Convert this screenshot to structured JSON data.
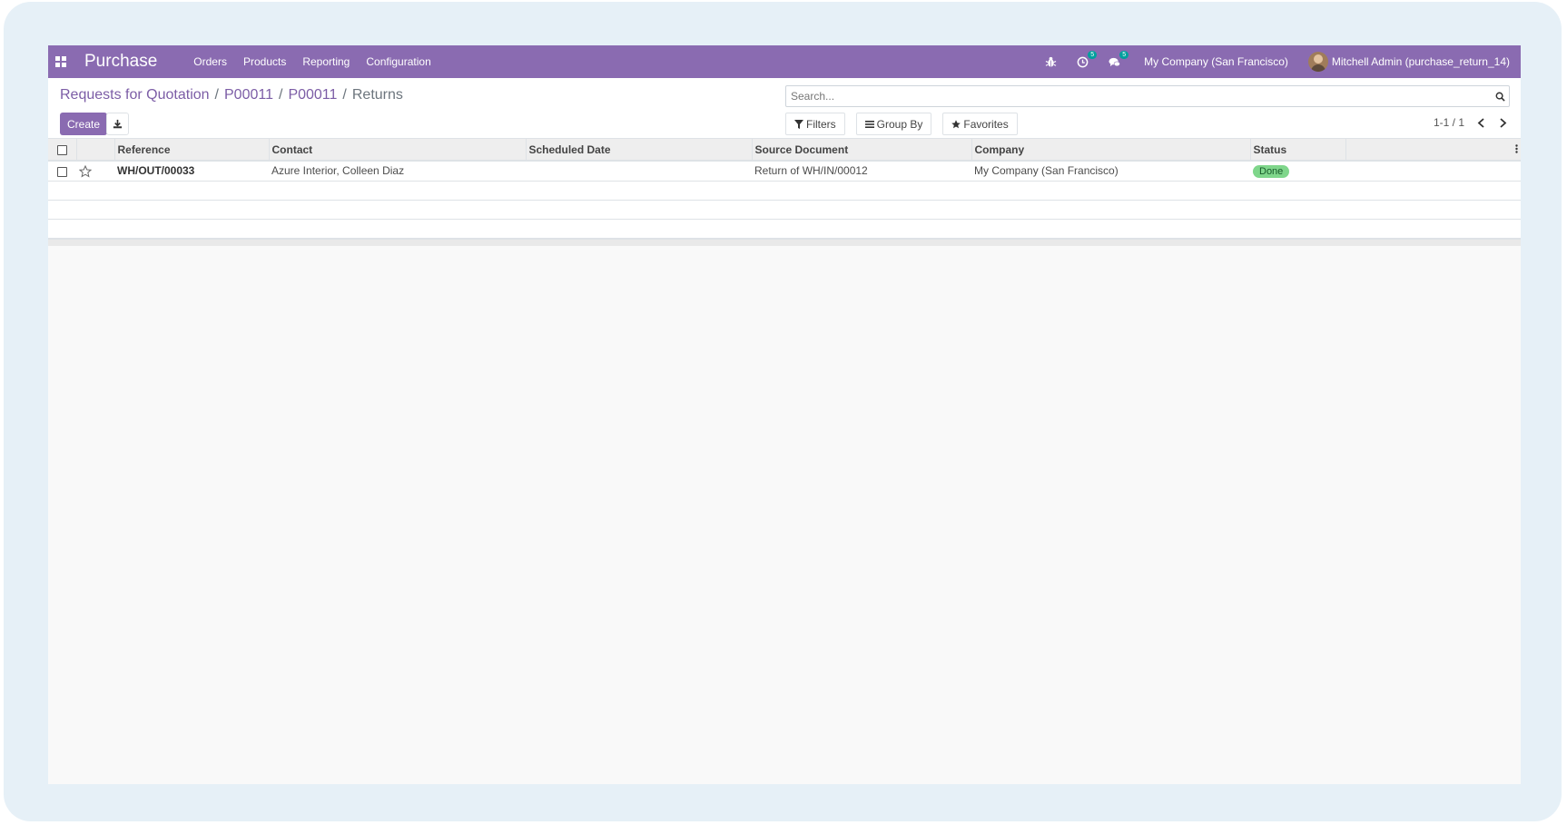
{
  "navbar": {
    "app_title": "Purchase",
    "menu": [
      "Orders",
      "Products",
      "Reporting",
      "Configuration"
    ],
    "activity_count": "5",
    "messages_count": "5",
    "company": "My Company (San Francisco)",
    "user": "Mitchell Admin (purchase_return_14)"
  },
  "breadcrumb": {
    "items": [
      "Requests for Quotation",
      "P00011",
      "P00011"
    ],
    "current": "Returns",
    "separator": "/"
  },
  "buttons": {
    "create": "Create"
  },
  "search": {
    "placeholder": "Search..."
  },
  "filters": {
    "filters_label": "Filters",
    "group_by_label": "Group By",
    "favorites_label": "Favorites"
  },
  "pager": {
    "value": "1-1 / 1"
  },
  "table": {
    "columns": [
      "Reference",
      "Contact",
      "Scheduled Date",
      "Source Document",
      "Company",
      "Status"
    ],
    "rows": [
      {
        "reference": "WH/OUT/00033",
        "contact": "Azure Interior, Colleen Diaz",
        "scheduled_date": "",
        "source_document": "Return of WH/IN/00012",
        "company": "My Company (San Francisco)",
        "status": "Done"
      }
    ]
  },
  "colors": {
    "navbar": "#8a6bb1",
    "link": "#7c5da6",
    "status_done": "#7fd68b",
    "badge": "#00a09d"
  }
}
